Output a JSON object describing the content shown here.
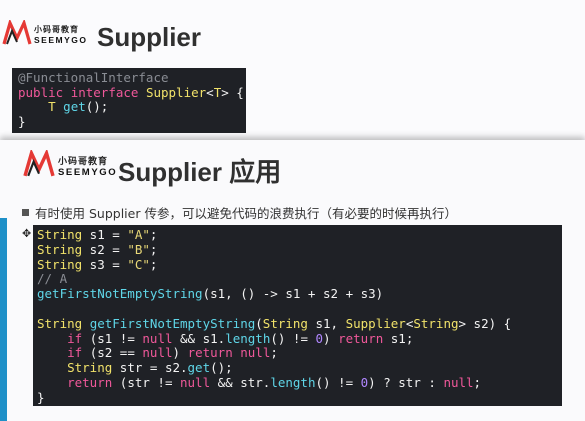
{
  "back_slide": {
    "logo": {
      "cn": "小码哥教育",
      "en": "SEEMYGO"
    },
    "title": "Supplier",
    "code": [
      [
        [
          "an",
          "@FunctionalInterface"
        ]
      ],
      [
        [
          "kw",
          "public"
        ],
        [
          "pl",
          " "
        ],
        [
          "kw",
          "interface"
        ],
        [
          "pl",
          " "
        ],
        [
          "ty",
          "Supplier"
        ],
        [
          "pl",
          "<"
        ],
        [
          "ty",
          "T"
        ],
        [
          "pl",
          "> {"
        ]
      ],
      [
        [
          "pl",
          "    "
        ],
        [
          "ty",
          "T"
        ],
        [
          "pl",
          " "
        ],
        [
          "fn",
          "get"
        ],
        [
          "pl",
          "();"
        ]
      ],
      [
        [
          "pl",
          "}"
        ]
      ]
    ]
  },
  "front_slide": {
    "logo": {
      "cn": "小码哥教育",
      "en": "SEEMYGO"
    },
    "title": "Supplier 应用",
    "bullet": "有时使用 Supplier 传参，可以避免代码的浪费执行（有必要的时候再执行）",
    "code": [
      [
        [
          "ty",
          "String"
        ],
        [
          "pl",
          " s1 = "
        ],
        [
          "st",
          "\"A\""
        ],
        [
          "pl",
          ";"
        ]
      ],
      [
        [
          "ty",
          "String"
        ],
        [
          "pl",
          " s2 = "
        ],
        [
          "st",
          "\"B\""
        ],
        [
          "pl",
          ";"
        ]
      ],
      [
        [
          "ty",
          "String"
        ],
        [
          "pl",
          " s3 = "
        ],
        [
          "st",
          "\"C\""
        ],
        [
          "pl",
          ";"
        ]
      ],
      [
        [
          "cm",
          "// A"
        ]
      ],
      [
        [
          "fn",
          "getFirstNotEmptyString"
        ],
        [
          "pl",
          "(s1, () -> s1 + s2 + s3)"
        ]
      ],
      [
        [
          "pl",
          ""
        ]
      ],
      [
        [
          "ty",
          "String"
        ],
        [
          "pl",
          " "
        ],
        [
          "fn",
          "getFirstNotEmptyString"
        ],
        [
          "pl",
          "("
        ],
        [
          "ty",
          "String"
        ],
        [
          "pl",
          " s1, "
        ],
        [
          "ty",
          "Supplier"
        ],
        [
          "pl",
          "<"
        ],
        [
          "ty",
          "String"
        ],
        [
          "pl",
          "> s2) {"
        ]
      ],
      [
        [
          "pl",
          "    "
        ],
        [
          "kw",
          "if"
        ],
        [
          "pl",
          " (s1 != "
        ],
        [
          "kw",
          "null"
        ],
        [
          "pl",
          " && s1."
        ],
        [
          "fn",
          "length"
        ],
        [
          "pl",
          "() != "
        ],
        [
          "nm",
          "0"
        ],
        [
          "pl",
          ") "
        ],
        [
          "kw",
          "return"
        ],
        [
          "pl",
          " s1;"
        ]
      ],
      [
        [
          "pl",
          "    "
        ],
        [
          "kw",
          "if"
        ],
        [
          "pl",
          " (s2 == "
        ],
        [
          "kw",
          "null"
        ],
        [
          "pl",
          ") "
        ],
        [
          "kw",
          "return"
        ],
        [
          "pl",
          " "
        ],
        [
          "kw",
          "null"
        ],
        [
          "pl",
          ";"
        ]
      ],
      [
        [
          "pl",
          "    "
        ],
        [
          "ty",
          "String"
        ],
        [
          "pl",
          " str = s2."
        ],
        [
          "fn",
          "get"
        ],
        [
          "pl",
          "();"
        ]
      ],
      [
        [
          "pl",
          "    "
        ],
        [
          "kw",
          "return"
        ],
        [
          "pl",
          " (str != "
        ],
        [
          "kw",
          "null"
        ],
        [
          "pl",
          " && str."
        ],
        [
          "fn",
          "length"
        ],
        [
          "pl",
          "() != "
        ],
        [
          "nm",
          "0"
        ],
        [
          "pl",
          ") ? str : "
        ],
        [
          "kw",
          "null"
        ],
        [
          "pl",
          ";"
        ]
      ],
      [
        [
          "pl",
          "}"
        ]
      ]
    ]
  },
  "colors": {
    "code_bg": "#1f2126",
    "keyword": "#f0589a",
    "type": "#f1e26a",
    "number": "#b086ff",
    "function": "#5fd6e8",
    "accent_bar": "#1e90c8"
  }
}
